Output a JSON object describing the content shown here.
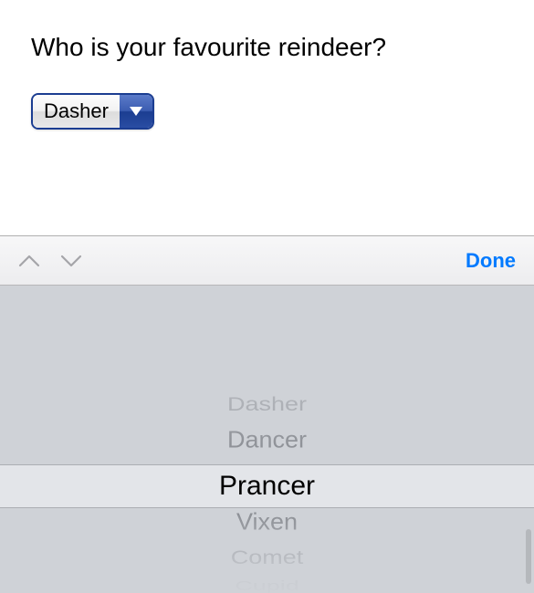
{
  "question": "Who is your favourite reindeer?",
  "dropdown": {
    "selected": "Dasher"
  },
  "accessory": {
    "done": "Done"
  },
  "picker": {
    "items": [
      "Dasher",
      "Dancer",
      "Prancer",
      "Vixen",
      "Comet",
      "Cupid"
    ],
    "selected": "Prancer"
  }
}
